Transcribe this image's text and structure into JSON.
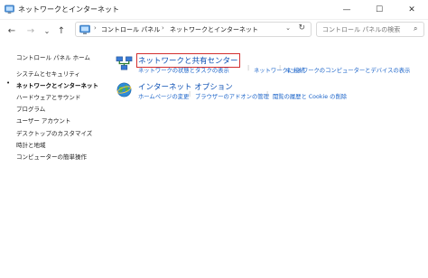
{
  "window": {
    "title": "ネットワークとインターネット",
    "minimize": "—",
    "maximize": "☐",
    "close": "✕"
  },
  "nav": {
    "back": "←",
    "forward": "→",
    "recent": "⌄",
    "up": "↑"
  },
  "address": {
    "crumbs": [
      "コントロール パネル",
      "ネットワークとインターネット"
    ],
    "separator": "›",
    "dropdown": "⌄",
    "refresh": "↻"
  },
  "search": {
    "placeholder": "コントロール パネルの検索",
    "icon": "⌕"
  },
  "sidebar": {
    "items": [
      {
        "label": "コントロール パネル ホーム",
        "active": false
      },
      {
        "label": "システムとセキュリティ",
        "active": false
      },
      {
        "label": "ネットワークとインターネット",
        "active": true
      },
      {
        "label": "ハードウェアとサウンド",
        "active": false
      },
      {
        "label": "プログラム",
        "active": false
      },
      {
        "label": "ユーザー アカウント",
        "active": false
      },
      {
        "label": "デスクトップのカスタマイズ",
        "active": false
      },
      {
        "label": "時計と地域",
        "active": false
      },
      {
        "label": "コンピューターの簡単操作",
        "active": false
      }
    ],
    "bullet": "•"
  },
  "categories": [
    {
      "title": "ネットワークと共有センター",
      "highlighted": true,
      "links": [
        "ネットワークの状態とタスクの表示",
        "ネットワークに接続",
        "ネットワークのコンピューターとデバイスの表示"
      ]
    },
    {
      "title": "インターネット オプション",
      "highlighted": false,
      "links": [
        "ホームページの変更",
        "ブラウザーのアドオンの管理",
        "閲覧の履歴と Cookie の削除"
      ]
    }
  ],
  "colors": {
    "link": "#1a63c9",
    "title_link": "#0b4fb4",
    "highlight_box": "#d32f2f"
  }
}
